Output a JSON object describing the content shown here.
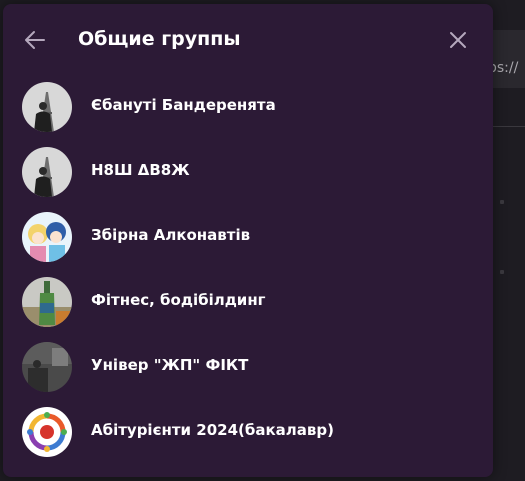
{
  "background": {
    "url_fragment": "ps://"
  },
  "dialog": {
    "title": "Общие группы",
    "back_icon": "arrow-left-icon",
    "close_icon": "close-icon"
  },
  "groups": [
    {
      "name": "Єбануті Бандеренята",
      "avatar": "photo-man-eiffel-tower"
    },
    {
      "name": "Н8Ш ΔВ8Ж",
      "avatar": "photo-man-eiffel-tower"
    },
    {
      "name": "Збірна Алконавтів",
      "avatar": "anime-characters"
    },
    {
      "name": "Фітнес, бодібілдинг",
      "avatar": "green-bottle"
    },
    {
      "name": "Універ \"ЖП\" ФІКТ",
      "avatar": "dark-room-photo"
    },
    {
      "name": "Абітурієнти 2024(бакалавр)",
      "avatar": "colorful-logo"
    }
  ],
  "colors": {
    "dialog_bg": "#2c1a36",
    "text": "#ffffff",
    "icon": "#b5a8bd"
  }
}
